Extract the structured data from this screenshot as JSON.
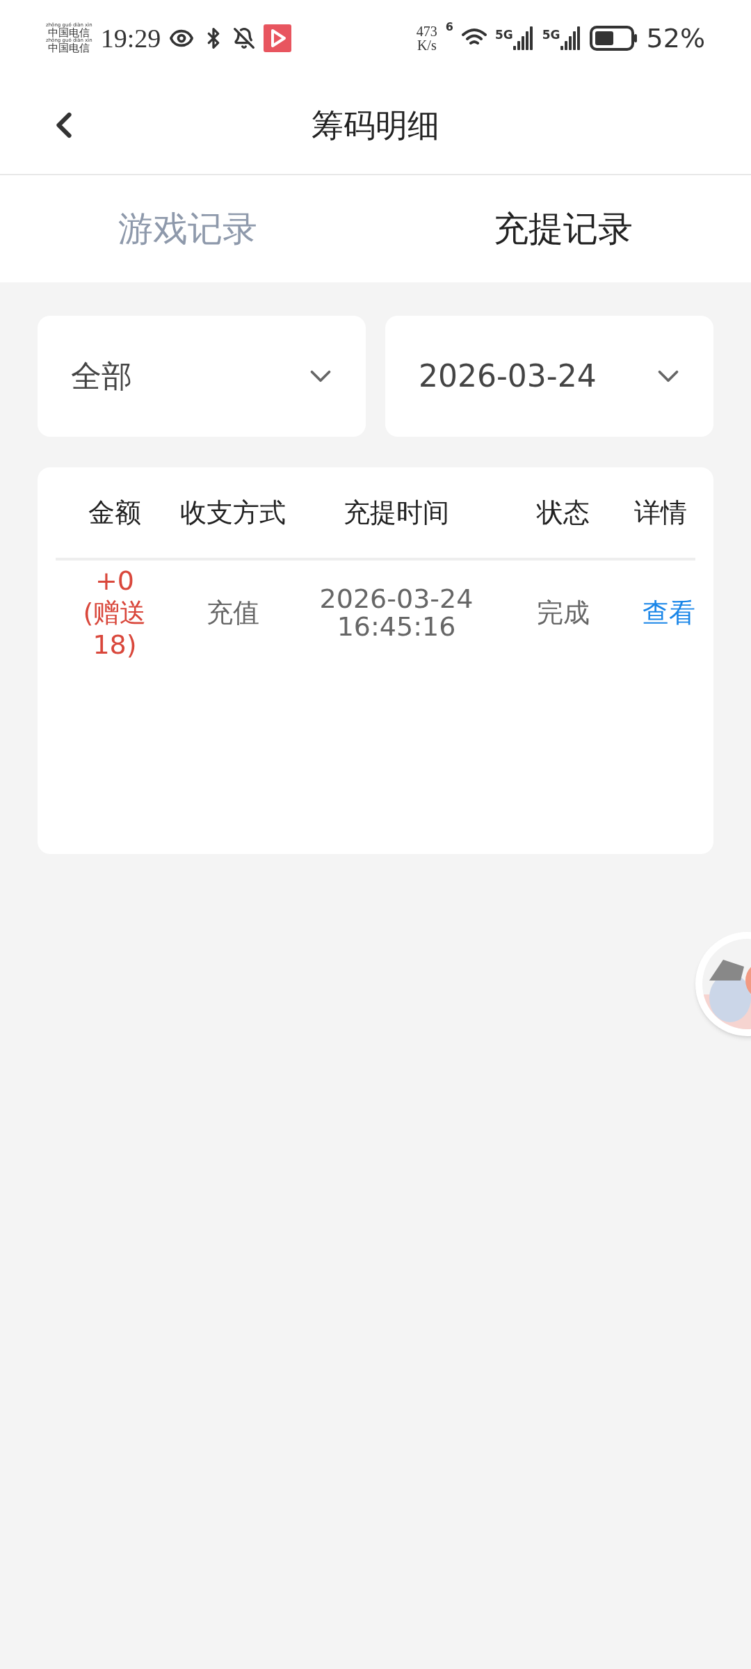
{
  "status_bar": {
    "carrier_lines": [
      {
        "pinyin": "zhōng guó diàn xìn",
        "text": "中国电信"
      },
      {
        "pinyin": "zhōng guó diàn xìn",
        "text": "中国电信"
      }
    ],
    "time": "19:29",
    "net_speed_value": "473",
    "net_speed_unit": "K/s",
    "wifi_badge": "6",
    "sim_badges": [
      "5G",
      "5G"
    ],
    "battery": "52%"
  },
  "header": {
    "title": "筹码明细"
  },
  "tabs": [
    {
      "label": "游戏记录",
      "selected": false
    },
    {
      "label": "充提记录",
      "selected": true
    }
  ],
  "filters": [
    {
      "value": "全部"
    },
    {
      "value": "2026-03-24"
    }
  ],
  "table": {
    "columns": [
      "金额",
      "收支方式",
      "充提时间",
      "状态",
      "详情"
    ],
    "rows": [
      {
        "amount": "+0 (赠送18)",
        "method": "充值",
        "date": "2026-03-24",
        "time": "16:45:16",
        "status": "完成",
        "detail": "查看"
      }
    ]
  }
}
